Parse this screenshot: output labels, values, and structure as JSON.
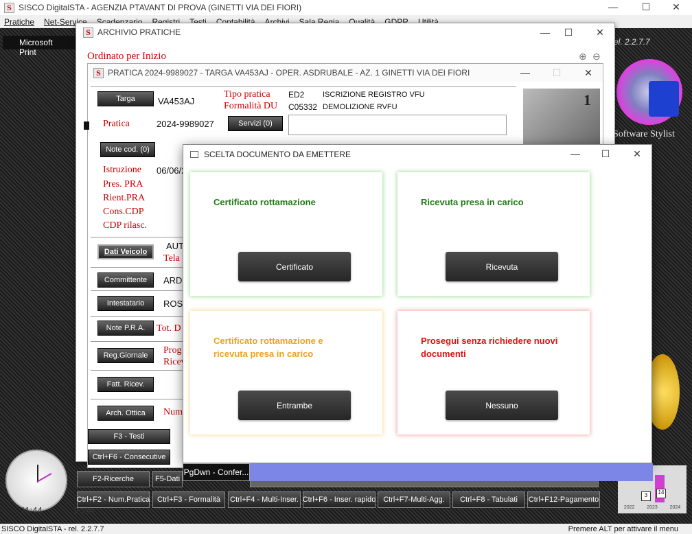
{
  "app": {
    "title": "SISCO DigitalSTA - AGENZIA PTAVANT DI PROVA (GINETTI VIA DEI FIORI)",
    "menu": [
      "Pratiche",
      "Net-Service",
      "Scadenzario",
      "Registri",
      "Testi",
      "Contabilità",
      "Archivi",
      "Sala Regia",
      "Qualità",
      "GDPR",
      "Utilità"
    ],
    "print_label": "Microsoft Print",
    "rel_label": "rel. 2.2.7.7",
    "brand": "Software Stylist",
    "clock_time": "11:44",
    "clock_year": "2024",
    "status_left": "SISCO DigitalSTA - rel. 2.2.7.7",
    "status_right": "Premere ALT per attivare il menu",
    "chart_years": [
      "2022",
      "2023",
      "2024"
    ],
    "bottom_row1": [
      "F2-Ricerche",
      "F5-Dati"
    ],
    "bottom_row2": [
      "Ctrl+F2 - Num.Pratica",
      "Ctrl+F3 - Formalità",
      "Ctrl+F4 - Multi-Inser.",
      "Ctrl+F6 - Inser. rapido",
      "Ctrl+F7-Multi-Agg.",
      "Ctrl+F8 - Tabulati",
      "Ctrl+F12-Pagamento"
    ]
  },
  "archive": {
    "title": "ARCHIVIO PRATICHE",
    "subtitle": "Ordinato per Inizio"
  },
  "pratica": {
    "title": "PRATICA 2024-9989027 - TARGA VA453AJ - OPER. ASDRUBALE - AZ. 1 GINETTI VIA DEI FIORI",
    "targa_btn": "Targa",
    "targa": "VA453AJ",
    "tipo_label": "Tipo pratica",
    "formalita_label": "Formalità DU",
    "tipo_code": "ED2",
    "tipo_desc": "ISCRIZIONE REGISTRO VFU",
    "form_code": "C05332",
    "form_desc": "DEMOLIZIONE RVFU",
    "pratica_label": "Pratica",
    "pratica_num": "2024-9989027",
    "servizi_btn": "Servizi (0)",
    "note_cod_btn": "Note cod. (0)",
    "istruzione_label": "Istruzione",
    "istruzione_date": "06/06/2",
    "pres_pra": "Pres. PRA",
    "rient_pra": "Rient.PRA",
    "cons_cdp": "Cons.CDP",
    "cdp_rilasc": "CDP rilasc.",
    "dati_veicolo_btn": "Dati Veicolo",
    "veicolo_val": "AUT",
    "telaio_label": "Tela",
    "committente_btn": "Committente",
    "committente_val": "ARD",
    "intestatario_btn": "Intestatario",
    "intestatario_val": "ROS",
    "note_pra_btn": "Note P.R.A.",
    "tot_label": "Tot. D",
    "reg_giornale_btn": "Reg.Giornale",
    "prog_label": "Prog",
    "ricev_label": "Ricev",
    "fatt_ricev_btn": "Fatt. Ricev.",
    "arch_ottica_btn": "Arch. Ottica",
    "num_label": "Num",
    "f3_btn": "F3 - Testi",
    "ctrl_f6_btn": "Ctrl+F6 - Consecutive",
    "page_num": "1"
  },
  "dialog": {
    "title": "SCELTA DOCUMENTO DA EMETTERE",
    "cards": [
      {
        "text": "Certificato rottamazione",
        "button": "Certificato",
        "color": "#1f7a12"
      },
      {
        "text": "Ricevuta presa in carico",
        "button": "Ricevuta",
        "color": "#1f7a12"
      },
      {
        "text": "Certificato rottamazione e ricevuta presa in carico",
        "button": "Entrambe",
        "color": "#f0a020"
      },
      {
        "text": "Prosegui senza richiedere nuovi documenti",
        "button": "Nessuno",
        "color": "#e01010"
      }
    ],
    "pgdwn": "PgDwn - Confer..."
  }
}
